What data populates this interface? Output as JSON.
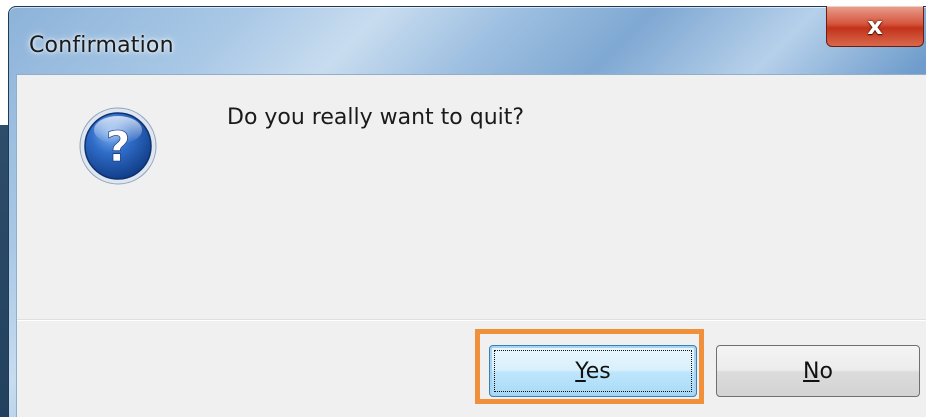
{
  "window": {
    "title": "Confirmation"
  },
  "titlebar": {
    "close_glyph": "x"
  },
  "dialog": {
    "message": "Do you really want to quit?",
    "icon": "question-icon"
  },
  "buttons": {
    "yes": {
      "accel": "Y",
      "rest": "es"
    },
    "no": {
      "accel": "N",
      "rest": "o"
    }
  },
  "colors": {
    "highlight": "#f0903a",
    "close_button": "#c2331a",
    "icon_blue": "#1f56b0"
  }
}
